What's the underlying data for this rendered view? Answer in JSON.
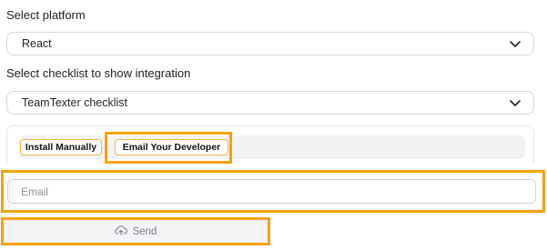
{
  "platform": {
    "label": "Select platform",
    "selected": "React"
  },
  "checklist": {
    "label": "Select checklist to show integration",
    "selected": "TeamTexter checklist"
  },
  "tabs": [
    {
      "label": "Install Manually"
    },
    {
      "label": "Email Your Developer"
    }
  ],
  "email": {
    "placeholder": "Email",
    "value": ""
  },
  "send": {
    "label": "Send",
    "icon": "cloud-upload-icon"
  },
  "colors": {
    "highlight": "#f5a20c",
    "tab_border": "#f0b640"
  }
}
